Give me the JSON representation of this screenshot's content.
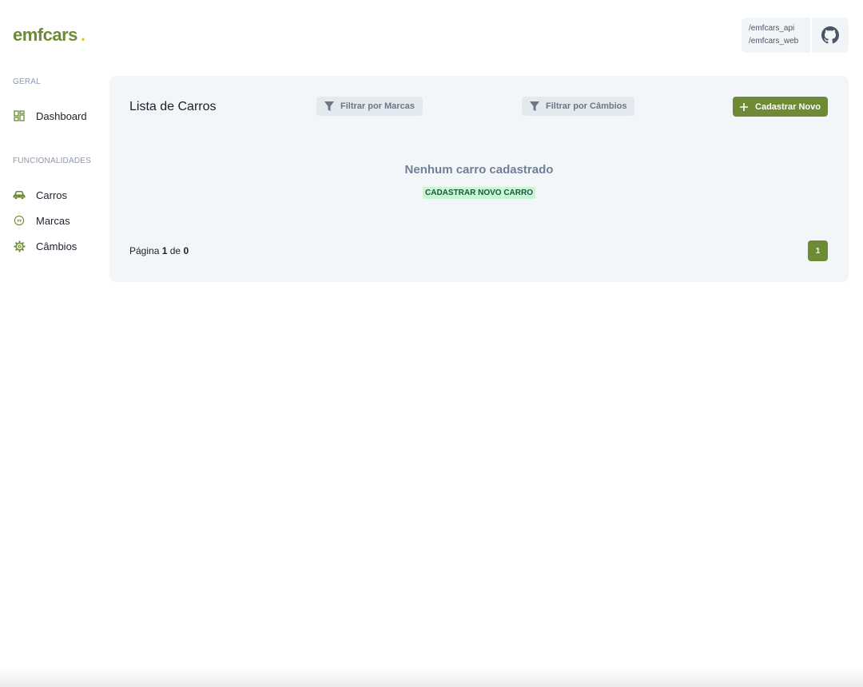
{
  "colors": {
    "brand": "#6f8a35",
    "accent_dot": "#d6c640",
    "button": "#6f8a35"
  },
  "header": {
    "logo_text": "emfcars",
    "logo_dot": ".",
    "repo_links": [
      "/emfcars_api",
      "/emfcars_web"
    ],
    "github_icon": "github-icon"
  },
  "sidebar": {
    "sections": [
      {
        "label": "GERAL",
        "items": [
          {
            "label": "Dashboard",
            "icon": "dashboard-icon"
          }
        ]
      },
      {
        "label": "FUNCIONALIDADES",
        "items": [
          {
            "label": "Carros",
            "icon": "car-icon"
          },
          {
            "label": "Marcas",
            "icon": "brand-icon"
          },
          {
            "label": "Câmbios",
            "icon": "gear-icon"
          }
        ]
      }
    ]
  },
  "main": {
    "title": "Lista de Carros",
    "filters": [
      {
        "label": "Filtrar por Marcas",
        "icon": "filter-icon"
      },
      {
        "label": "Filtrar por Câmbios",
        "icon": "filter-icon"
      }
    ],
    "add_button": {
      "label": "Cadastrar Novo",
      "icon": "plus-icon"
    },
    "empty_state": {
      "title": "Nenhum carro cadastrado",
      "link": "CADASTRAR NOVO CARRO"
    },
    "pagination": {
      "prefix": "Página",
      "current": "1",
      "separator": "de",
      "total": "0",
      "pages": [
        "1"
      ]
    }
  }
}
